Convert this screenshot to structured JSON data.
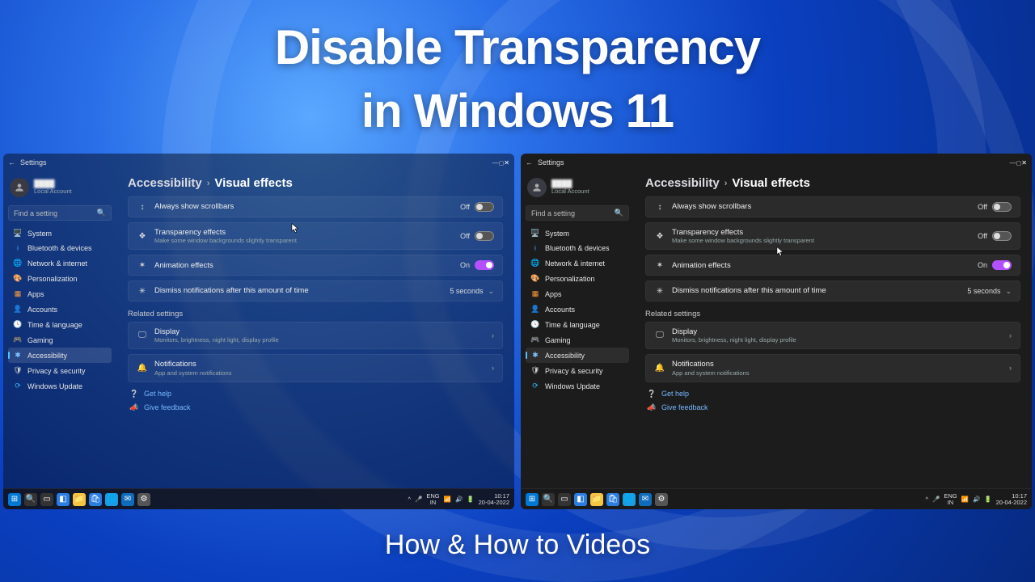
{
  "hero": {
    "line1": "Disable Transparency",
    "line2": "in Windows 11",
    "footer": "How & How to Videos"
  },
  "window": {
    "title": "Settings",
    "back_aria": "Back"
  },
  "account": {
    "name_redacted": "████",
    "subtype": "Local Account"
  },
  "search": {
    "placeholder": "Find a setting"
  },
  "sidebar": [
    {
      "icon": "🖥️",
      "label": "System",
      "cls": "ic-sys"
    },
    {
      "icon": "ᚼ",
      "label": "Bluetooth & devices",
      "cls": "ic-bt"
    },
    {
      "icon": "🌐",
      "label": "Network & internet",
      "cls": "ic-net"
    },
    {
      "icon": "🎨",
      "label": "Personalization",
      "cls": "ic-pers"
    },
    {
      "icon": "▦",
      "label": "Apps",
      "cls": "ic-apps"
    },
    {
      "icon": "👤",
      "label": "Accounts",
      "cls": "ic-acct"
    },
    {
      "icon": "🕓",
      "label": "Time & language",
      "cls": "ic-time"
    },
    {
      "icon": "🎮",
      "label": "Gaming",
      "cls": "ic-game"
    },
    {
      "icon": "✱",
      "label": "Accessibility",
      "cls": "ic-acc",
      "active": true
    },
    {
      "icon": "🛡",
      "label": "Privacy & security",
      "cls": "ic-priv"
    },
    {
      "icon": "⟳",
      "label": "Windows Update",
      "cls": "ic-upd"
    }
  ],
  "breadcrumb": {
    "parent": "Accessibility",
    "sep": "›",
    "current": "Visual effects"
  },
  "rows": {
    "scrollbars": {
      "icon": "↕",
      "title": "Always show scrollbars",
      "state_label": "Off",
      "on": false
    },
    "transparency": {
      "icon": "❖",
      "title": "Transparency effects",
      "sub": "Make some window backgrounds slightly transparent",
      "state_label": "Off",
      "on": false
    },
    "animation": {
      "icon": "✶",
      "title": "Animation effects",
      "state_label": "On",
      "on": true
    },
    "dismiss": {
      "icon": "✳",
      "title": "Dismiss notifications after this amount of time",
      "value": "5 seconds"
    }
  },
  "related": {
    "header": "Related settings",
    "display": {
      "icon": "🖵",
      "title": "Display",
      "sub": "Monitors, brightness, night light, display profile"
    },
    "notifications": {
      "icon": "🔔",
      "title": "Notifications",
      "sub": "App and system notifications"
    }
  },
  "footer_links": {
    "help": {
      "icon": "❔",
      "label": "Get help"
    },
    "feedback": {
      "icon": "📣",
      "label": "Give feedback"
    }
  },
  "taskbar": {
    "lang": "ENG",
    "region": "IN",
    "time": "10:17",
    "date": "20-04-2022"
  }
}
